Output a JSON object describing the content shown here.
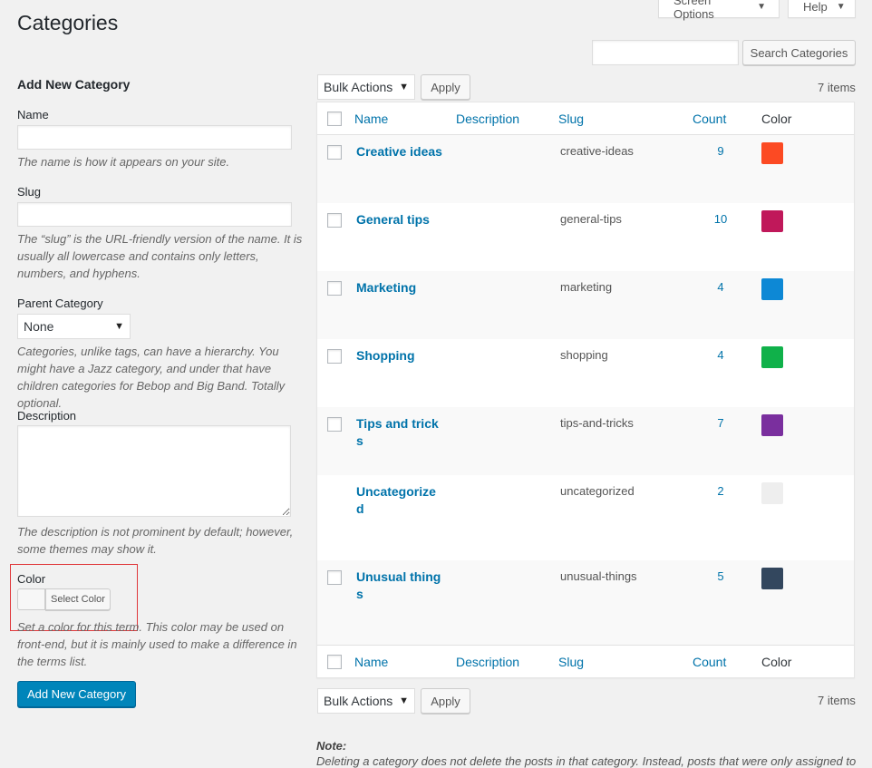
{
  "page": {
    "title": "Categories",
    "screen_options": "Screen Options",
    "help": "Help",
    "search_button": "Search Categories",
    "search_value": ""
  },
  "form": {
    "heading": "Add New Category",
    "name_label": "Name",
    "name_help": "The name is how it appears on your site.",
    "slug_label": "Slug",
    "slug_help": "The “slug” is the URL-friendly version of the name. It is usually all lowercase and contains only letters, numbers, and hyphens.",
    "parent_label": "Parent Category",
    "parent_value": "None",
    "parent_help": "Categories, unlike tags, can have a hierarchy. You might have a Jazz category, and under that have children categories for Bebop and Big Band. Totally optional.",
    "description_label": "Description",
    "description_help": "The description is not prominent by default; however, some themes may show it.",
    "color_label": "Color",
    "color_button": "Select Color",
    "color_help": "Set a color for this term. This color may be used on front-end, but it is mainly used to make a difference in the terms list.",
    "submit": "Add New Category"
  },
  "table": {
    "bulk_actions": "Bulk Actions",
    "apply": "Apply",
    "items_count": "7 items",
    "columns": {
      "name": "Name",
      "description": "Description",
      "slug": "Slug",
      "count": "Count",
      "color": "Color"
    },
    "rows": [
      {
        "name": "Creative ideas",
        "slug": "creative-ideas",
        "count": "9",
        "color": "#fc4a23"
      },
      {
        "name": "General tips",
        "slug": "general-tips",
        "count": "10",
        "color": "#c0185a"
      },
      {
        "name": "Marketing",
        "slug": "marketing",
        "count": "4",
        "color": "#0d88d5"
      },
      {
        "name": "Shopping",
        "slug": "shopping",
        "count": "4",
        "color": "#10b14a"
      },
      {
        "name": "Tips and tricks",
        "slug": "tips-and-tricks",
        "count": "7",
        "color": "#7a2f9e"
      },
      {
        "name": "Uncategorized",
        "slug": "uncategorized",
        "count": "2",
        "color": "#eeeeee"
      },
      {
        "name": "Unusual things",
        "slug": "unusual-things",
        "count": "5",
        "color": "#33475e"
      }
    ]
  },
  "note": {
    "title": "Note:",
    "text": "Deleting a category does not delete the posts in that category. Instead, posts that were only assigned to"
  }
}
